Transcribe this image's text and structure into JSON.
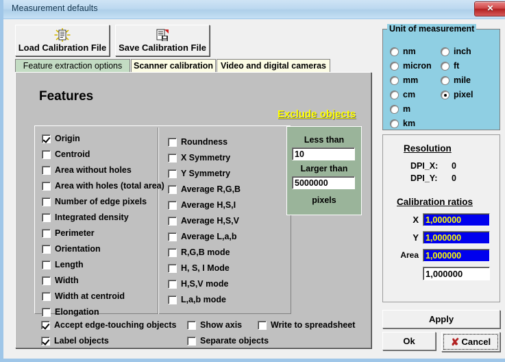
{
  "window": {
    "title": "Measurement defaults",
    "close_glyph": "✕"
  },
  "toolbar": {
    "load_label": "Load Calibration File",
    "save_label": "Save Calibration File"
  },
  "tabs": [
    {
      "label": "Feature extraction options",
      "active": true
    },
    {
      "label": "Scanner calibration",
      "active": false
    },
    {
      "label": "Video and digital cameras",
      "active": false
    }
  ],
  "main": {
    "features_title": "Features",
    "exclude_title": "Exclude objects"
  },
  "features_left": [
    {
      "label": "Origin",
      "checked": true
    },
    {
      "label": "Centroid",
      "checked": false
    },
    {
      "label": "Area without holes",
      "checked": false
    },
    {
      "label": "Area with holes (total area)",
      "checked": false
    },
    {
      "label": "Number of edge pixels",
      "checked": false
    },
    {
      "label": "Integrated density",
      "checked": false
    },
    {
      "label": "Perimeter",
      "checked": false
    },
    {
      "label": "Orientation",
      "checked": false
    },
    {
      "label": "Length",
      "checked": false
    },
    {
      "label": "Width",
      "checked": false
    },
    {
      "label": "Width at centroid",
      "checked": false
    },
    {
      "label": "Elongation",
      "checked": false
    }
  ],
  "features_right": [
    {
      "label": "Roundness",
      "checked": false
    },
    {
      "label": "X Symmetry",
      "checked": false
    },
    {
      "label": "Y Symmetry",
      "checked": false
    },
    {
      "label": "Average R,G,B",
      "checked": false
    },
    {
      "label": "Average H,S,I",
      "checked": false
    },
    {
      "label": "Average H,S,V",
      "checked": false
    },
    {
      "label": "Average L,a,b",
      "checked": false
    },
    {
      "label": "R,G,B mode",
      "checked": false
    },
    {
      "label": "H, S, I Mode",
      "checked": false
    },
    {
      "label": "H,S,V mode",
      "checked": false
    },
    {
      "label": "L,a,b mode",
      "checked": false
    }
  ],
  "exclude": {
    "less_than_label": "Less than",
    "less_than_value": "10",
    "larger_than_label": "Larger than",
    "larger_than_value": "5000000",
    "units_label": "pixels"
  },
  "bottom_options": [
    {
      "label": "Accept edge-touching objects",
      "checked": true
    },
    {
      "label": "Label objects",
      "checked": true
    },
    {
      "label": "Show axis",
      "checked": false
    },
    {
      "label": "Separate objects",
      "checked": false
    },
    {
      "label": "Write to spreadsheet",
      "checked": false
    }
  ],
  "unit_group": {
    "legend": "Unit of measurement",
    "options_col1": [
      {
        "label": "nm",
        "selected": false
      },
      {
        "label": "micron",
        "selected": false
      },
      {
        "label": "mm",
        "selected": false
      },
      {
        "label": "cm",
        "selected": false
      },
      {
        "label": "m",
        "selected": false
      },
      {
        "label": "km",
        "selected": false
      }
    ],
    "options_col2": [
      {
        "label": "inch",
        "selected": false
      },
      {
        "label": "ft",
        "selected": false
      },
      {
        "label": "mile",
        "selected": false
      },
      {
        "label": "pixel",
        "selected": true
      }
    ]
  },
  "resolution": {
    "heading": "Resolution",
    "dpi_x_label": "DPI_X:",
    "dpi_x_value": "0",
    "dpi_y_label": "DPI_Y:",
    "dpi_y_value": "0",
    "calibration_heading": "Calibration ratios",
    "x_label": "X",
    "x_value": "1,000000",
    "y_label": "Y",
    "y_value": "1,000000",
    "area_label": "Area",
    "area_value": "1,000000",
    "extra_value": "1,000000"
  },
  "actions": {
    "apply": "Apply",
    "ok": "Ok",
    "cancel": "Cancel",
    "cancel_icon": "✘"
  },
  "colors": {
    "titlebar": "#bdd9f0",
    "close_red": "#b22222",
    "panel_grey": "#c0c0c0",
    "tab_active": "#c3dcc3",
    "tab_inactive": "#fcfce4",
    "exclude_green": "#9ab49a",
    "unit_blue": "#8fcfe3",
    "ratio_field_bg": "#0000ee",
    "ratio_field_fg": "#ffff00",
    "exclude_title": "#ffff00"
  }
}
